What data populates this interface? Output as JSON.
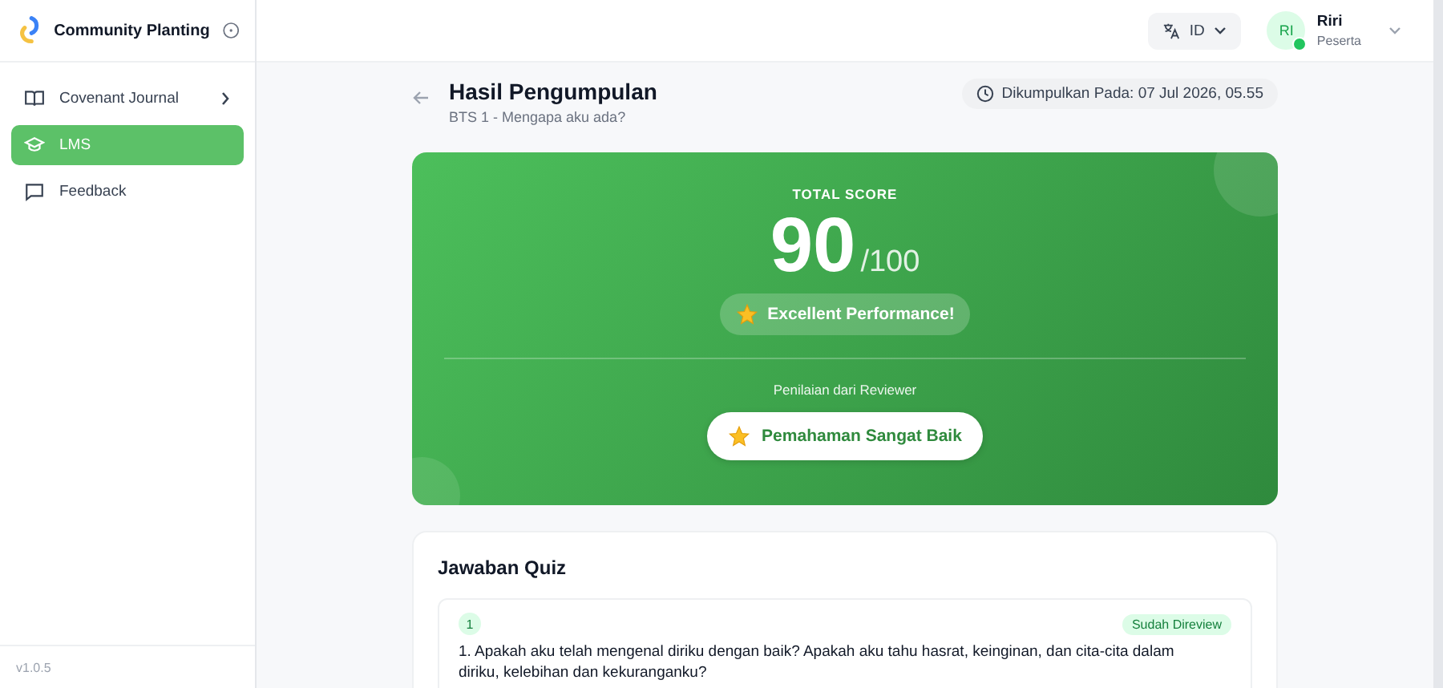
{
  "sidebar": {
    "app_name": "Community Planting",
    "items": [
      {
        "label": "Covenant Journal",
        "has_submenu": true,
        "selected": false
      },
      {
        "label": "LMS",
        "has_submenu": false,
        "selected": true
      },
      {
        "label": "Feedback",
        "has_submenu": false,
        "selected": false
      }
    ],
    "version": "v1.0.5"
  },
  "topbar": {
    "language": "ID",
    "user": {
      "initials": "RI",
      "name": "Riri",
      "role": "Peserta",
      "online": true
    }
  },
  "header": {
    "title": "Hasil Pengumpulan",
    "subtitle": "BTS 1 - Mengapa aku ada?",
    "submitted": "Dikumpulkan Pada: 07 Jul 2026, 05.55"
  },
  "score": {
    "label": "TOTAL SCORE",
    "value": "90",
    "max": "/100",
    "badge": "Excellent Performance!",
    "reviewer_label": "Penilaian dari Reviewer",
    "reviewer_rating": "Pemahaman Sangat Baik"
  },
  "quiz": {
    "title": "Jawaban Quiz",
    "questions": [
      {
        "number": "1",
        "status": "Sudah Direview",
        "reviewed": true,
        "question": "1. Apakah aku telah mengenal diriku dengan baik? Apakah aku tahu hasrat, keinginan, dan cita-cita dalam diriku, kelebihan dan kekuranganku?"
      }
    ]
  }
}
